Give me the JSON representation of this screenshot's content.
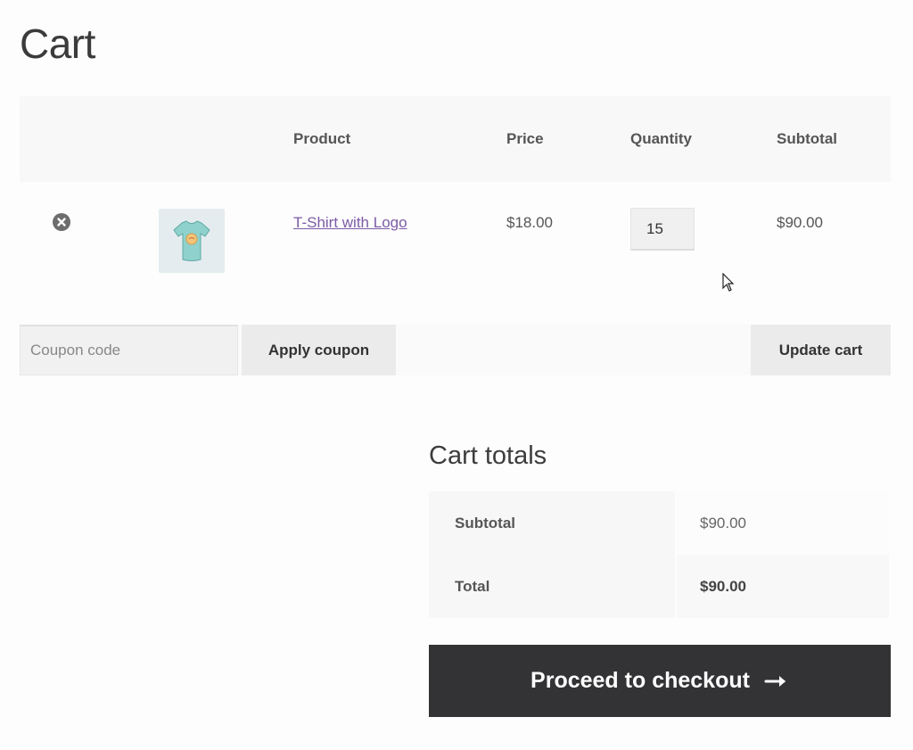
{
  "page": {
    "title": "Cart"
  },
  "cart": {
    "headers": {
      "product": "Product",
      "price": "Price",
      "quantity": "Quantity",
      "subtotal": "Subtotal"
    },
    "items": [
      {
        "name": "T-Shirt with Logo",
        "price": "$18.00",
        "quantity": "15",
        "subtotal": "$90.00",
        "thumbnail_icon": "tshirt-icon",
        "remove_icon": "remove-circle-icon"
      }
    ],
    "coupon_placeholder": "Coupon code",
    "apply_coupon_label": "Apply coupon",
    "update_cart_label": "Update cart"
  },
  "totals": {
    "title": "Cart totals",
    "subtotal_label": "Subtotal",
    "subtotal_value": "$90.00",
    "total_label": "Total",
    "total_value": "$90.00"
  },
  "checkout": {
    "label": "Proceed to checkout",
    "icon": "arrow-right-icon"
  },
  "colors": {
    "link": "#7b5ba6",
    "checkout_bg": "#333335",
    "button_bg": "#ebebeb"
  }
}
